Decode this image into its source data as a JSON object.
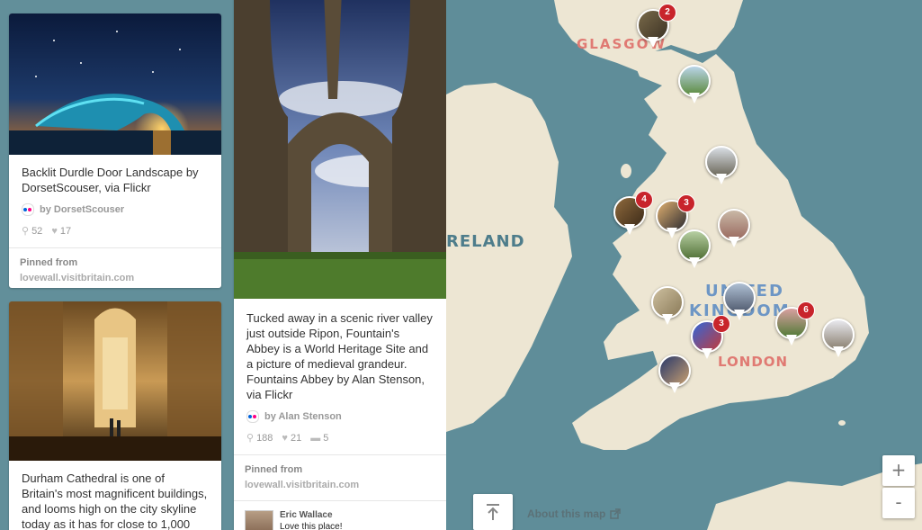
{
  "pins": [
    {
      "description": "Backlit Durdle Door Landscape by DorsetScouser, via Flickr",
      "attribution": "by DorsetScouser",
      "repins": "52",
      "likes": "17",
      "pinned_label": "Pinned from",
      "source": "lovewall.visitbritain.com"
    },
    {
      "description": "Tucked away in a scenic river valley just outside Ripon, Fountain's Abbey is a World Heritage Site and a picture of medieval grandeur. Fountains Abbey by Alan Stenson, via Flickr",
      "attribution": "by Alan Stenson",
      "repins": "188",
      "likes": "21",
      "comments": "5",
      "pinned_label": "Pinned from",
      "source": "lovewall.visitbritain.com",
      "comment_author": "Eric Wallace",
      "comment_text": "Love this place!"
    },
    {
      "description": "Durham Cathedral is one of Britain's most magnificent buildings, and looms high on the city skyline today as it has for close to 1,000"
    }
  ],
  "map": {
    "labels": {
      "glasgow": "GLASGOW",
      "ireland": "RELAND",
      "united": "UNITED",
      "kingdom": "KINGDOM",
      "london": "LONDON"
    },
    "markers": [
      {
        "count": "2",
        "icon": "photo-thumbnail"
      },
      {
        "count": "",
        "icon": "photo-thumbnail"
      },
      {
        "count": "",
        "icon": "photo-thumbnail"
      },
      {
        "count": "4",
        "icon": "photo-thumbnail"
      },
      {
        "count": "3",
        "icon": "photo-thumbnail"
      },
      {
        "count": "",
        "icon": "photo-thumbnail"
      },
      {
        "count": "",
        "icon": "photo-thumbnail"
      },
      {
        "count": "",
        "icon": "photo-thumbnail"
      },
      {
        "count": "",
        "icon": "photo-thumbnail"
      },
      {
        "count": "3",
        "icon": "photo-thumbnail"
      },
      {
        "count": "6",
        "icon": "photo-thumbnail"
      },
      {
        "count": "",
        "icon": "photo-thumbnail"
      },
      {
        "count": "",
        "icon": "photo-thumbnail"
      }
    ],
    "zoom_in": "+",
    "zoom_out": "-",
    "about": "About this map",
    "icons": {
      "scroll_top": "arrow-up-to-line-icon",
      "external": "external-link-icon"
    }
  },
  "colors": {
    "sea": "#5f8d99",
    "land": "#ede6d3",
    "marker_badge": "#c8242b"
  }
}
